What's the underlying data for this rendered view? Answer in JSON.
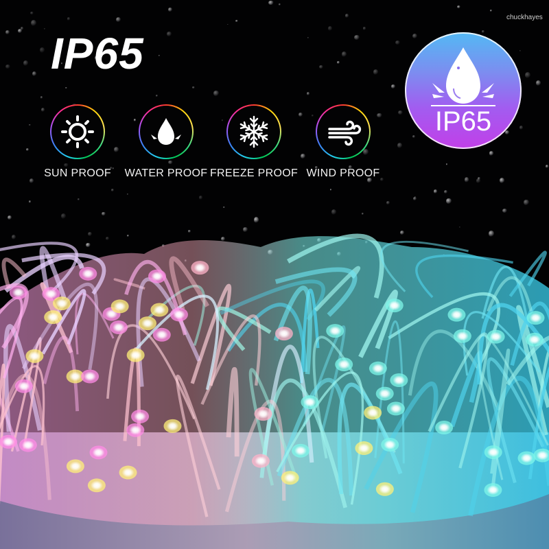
{
  "image": {
    "headline": "IP65",
    "watermark": "chuckhayes",
    "badge": {
      "icon": "water-drop-splash-icon",
      "label": "IP65",
      "gradient_colors": [
        "#53b9f4",
        "#a25cf0",
        "#c23fe8"
      ]
    },
    "features": [
      {
        "icon": "sun-icon",
        "label": "SUN PROOF"
      },
      {
        "icon": "water-drop-icon",
        "label": "WATER PROOF"
      },
      {
        "icon": "snowflake-icon",
        "label": "FREEZE PROOF"
      },
      {
        "icon": "wind-icon",
        "label": "WIND PROOF"
      }
    ],
    "scene": {
      "subject": "tangled LED string lights splashing in water",
      "light_colors": [
        "#ff8ce6",
        "#ffb3c8",
        "#fff07a",
        "#7ff5e8",
        "#4fd8f0",
        "#ffffff"
      ],
      "background_color": "#020203"
    }
  }
}
